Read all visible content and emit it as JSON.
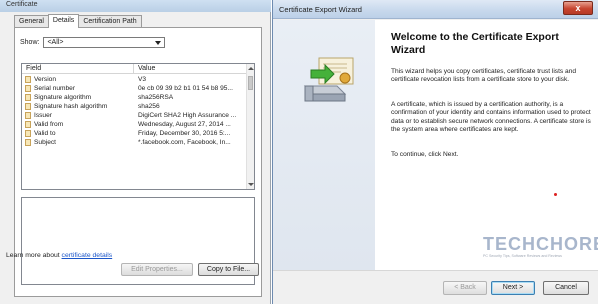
{
  "certificate_dialog": {
    "window_title": "Certificate",
    "tabs": [
      {
        "label": "General"
      },
      {
        "label": "Details"
      },
      {
        "label": "Certification Path"
      }
    ],
    "show_label": "Show:",
    "show_value": "<All>",
    "columns": {
      "field": "Field",
      "value": "Value"
    },
    "rows": [
      {
        "field": "Version",
        "value": "V3"
      },
      {
        "field": "Serial number",
        "value": "0e cb 09 39 b2 b1 01 54 b8 95..."
      },
      {
        "field": "Signature algorithm",
        "value": "sha256RSA"
      },
      {
        "field": "Signature hash algorithm",
        "value": "sha256"
      },
      {
        "field": "Issuer",
        "value": "DigiCert SHA2 High Assurance ..."
      },
      {
        "field": "Valid from",
        "value": "Wednesday, August 27, 2014 ..."
      },
      {
        "field": "Valid to",
        "value": "Friday, December 30, 2016 5:..."
      },
      {
        "field": "Subject",
        "value": "*.facebook.com, Facebook, In..."
      }
    ],
    "edit_properties_label": "Edit Properties...",
    "copy_to_file_label": "Copy to File...",
    "learn_more_prefix": "Learn more about",
    "learn_more_link": "certificate details"
  },
  "wizard": {
    "window_title": "Certificate Export Wizard",
    "close_glyph": "x",
    "heading": "Welcome to the Certificate Export Wizard",
    "para1": "This wizard helps you copy certificates, certificate trust lists and certificate revocation lists from a certificate store to your disk.",
    "para2": "A certificate, which is issued by a certification authority, is a confirmation of your identity and contains information used to protect data or to establish secure network connections. A certificate store is the system area where certificates are kept.",
    "para3": "To continue, click Next.",
    "watermark": {
      "text": "TECHCHORE",
      "subtext": "PC Security Tips, Software Reviews and Reviews"
    },
    "buttons": {
      "back": "< Back",
      "next": "Next >",
      "cancel": "Cancel"
    },
    "icon": "certificate-wizard-icon"
  },
  "colors": {
    "link": "#1a55c9",
    "titlebar": "#c7d8ec",
    "close_button": "#c74530"
  }
}
